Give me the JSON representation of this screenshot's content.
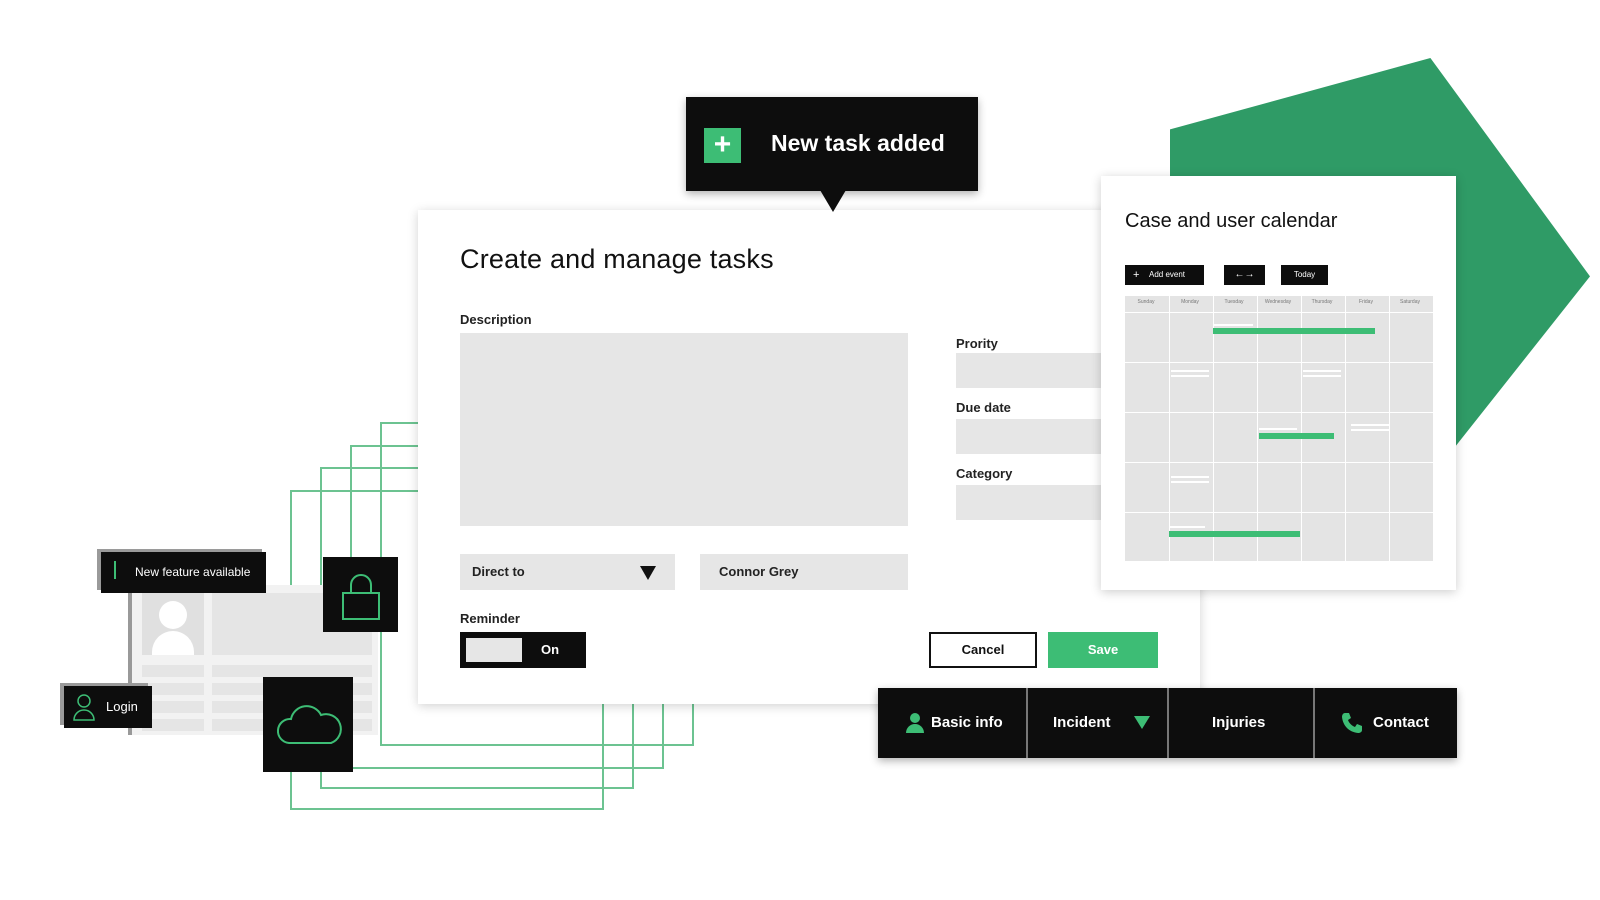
{
  "toast": {
    "icon": "plus-icon",
    "message": "New task added"
  },
  "task_panel": {
    "title": "Create and manage tasks",
    "description_label": "Description",
    "priority_label": "Prority",
    "due_date_label": "Due date",
    "category_label": "Category",
    "direct_to_label": "Direct to",
    "assignee_value": "Connor Grey",
    "reminder_label": "Reminder",
    "reminder_toggle": "On",
    "cancel_label": "Cancel",
    "save_label": "Save"
  },
  "calendar": {
    "title": "Case and user calendar",
    "add_event_label": "Add event",
    "prev_next_label": "←→",
    "today_label": "Today",
    "days": [
      "Sunday",
      "Monday",
      "Tuesday",
      "Wednesday",
      "Thursday",
      "Friday",
      "Saturday"
    ]
  },
  "bottom_nav": {
    "items": [
      "Basic info",
      "Incident",
      "Injuries",
      "Contact"
    ]
  },
  "widgets": {
    "new_feature_label": "New feature available",
    "login_label": "Login"
  },
  "colors": {
    "accent_green": "#3dbd75",
    "shape_green": "#2f9b66",
    "dark": "#0d0d0d"
  }
}
